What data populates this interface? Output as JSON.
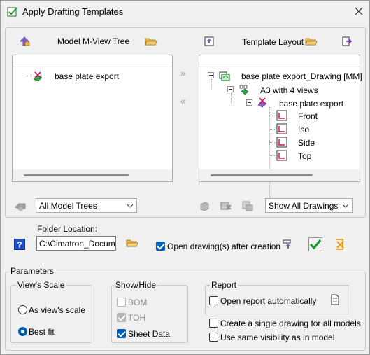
{
  "window": {
    "title": "Apply Drafting Templates"
  },
  "left_panel": {
    "header_label": "Model M-View Tree",
    "tree": [
      {
        "label": "base plate export"
      }
    ],
    "filter_select": {
      "value": "All Model Trees"
    }
  },
  "right_panel": {
    "header_label": "Template Layout",
    "tree": {
      "root": "base plate export_Drawing [MM]",
      "sheet": "A3 with 4 views",
      "model": "base plate export",
      "views": [
        "Front",
        "Iso",
        "Side",
        "Top"
      ]
    },
    "filter_select": {
      "value": "Show All Drawings"
    }
  },
  "transfer": {
    "add_label": "»",
    "remove_label": "«"
  },
  "folder": {
    "label": "Folder Location:",
    "value": "C:\\Cimatron_Documen"
  },
  "open_after_creation": {
    "label": "Open drawing(s) after creation",
    "checked": true
  },
  "parameters": {
    "label": "Parameters",
    "views_scale": {
      "label": "View's Scale",
      "options": [
        {
          "label": "As view's scale",
          "selected": false
        },
        {
          "label": "Best fit",
          "selected": true
        }
      ]
    },
    "show_hide": {
      "label": "Show/Hide",
      "items": [
        {
          "label": "BOM",
          "checked": false,
          "enabled": false
        },
        {
          "label": "TOH",
          "checked": true,
          "enabled": false
        },
        {
          "label": "Sheet Data",
          "checked": true,
          "enabled": true
        }
      ]
    },
    "report": {
      "label": "Report",
      "open_automatically": {
        "label": "Open report automatically",
        "checked": false
      }
    },
    "single_drawing": {
      "label": "Create a single drawing for all models",
      "checked": false
    },
    "same_visibility": {
      "label": "Use same visibility as in model",
      "checked": false
    }
  },
  "colors": {
    "accent": "#005fb8",
    "check_green": "#1a9a2a",
    "folder_yellow": "#e8b73a"
  }
}
